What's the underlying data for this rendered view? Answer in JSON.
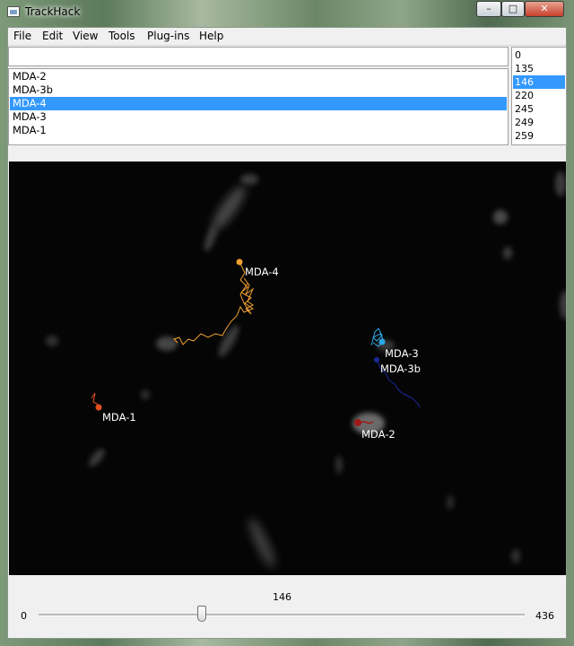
{
  "window": {
    "title": "TrackHack",
    "minimize_glyph": "–",
    "maximize_glyph": "□",
    "close_glyph": "✕"
  },
  "menu": {
    "items": [
      "File",
      "Edit",
      "View",
      "Tools",
      "Plug-ins",
      "Help"
    ]
  },
  "name_input": {
    "value": ""
  },
  "tracks": {
    "items": [
      "MDA-2",
      "MDA-3b",
      "MDA-4",
      "MDA-3",
      "MDA-1"
    ],
    "selected": "MDA-4"
  },
  "frames": {
    "items": [
      "0",
      "135",
      "146",
      "220",
      "245",
      "249",
      "259"
    ],
    "selected": "146"
  },
  "canvas": {
    "labels": {
      "mda4": "MDA-4",
      "mda3": "MDA-3",
      "mda3b": "MDA-3b",
      "mda1": "MDA-1",
      "mda2": "MDA-2"
    },
    "colors": {
      "mda4": "#f0a030",
      "mda3": "#29a8e8",
      "mda3b": "#1a2a9a",
      "mda1": "#e05020",
      "mda2": "#a01818"
    }
  },
  "slider": {
    "value": "146",
    "min": "0",
    "max": "436",
    "fraction": 0.335
  }
}
